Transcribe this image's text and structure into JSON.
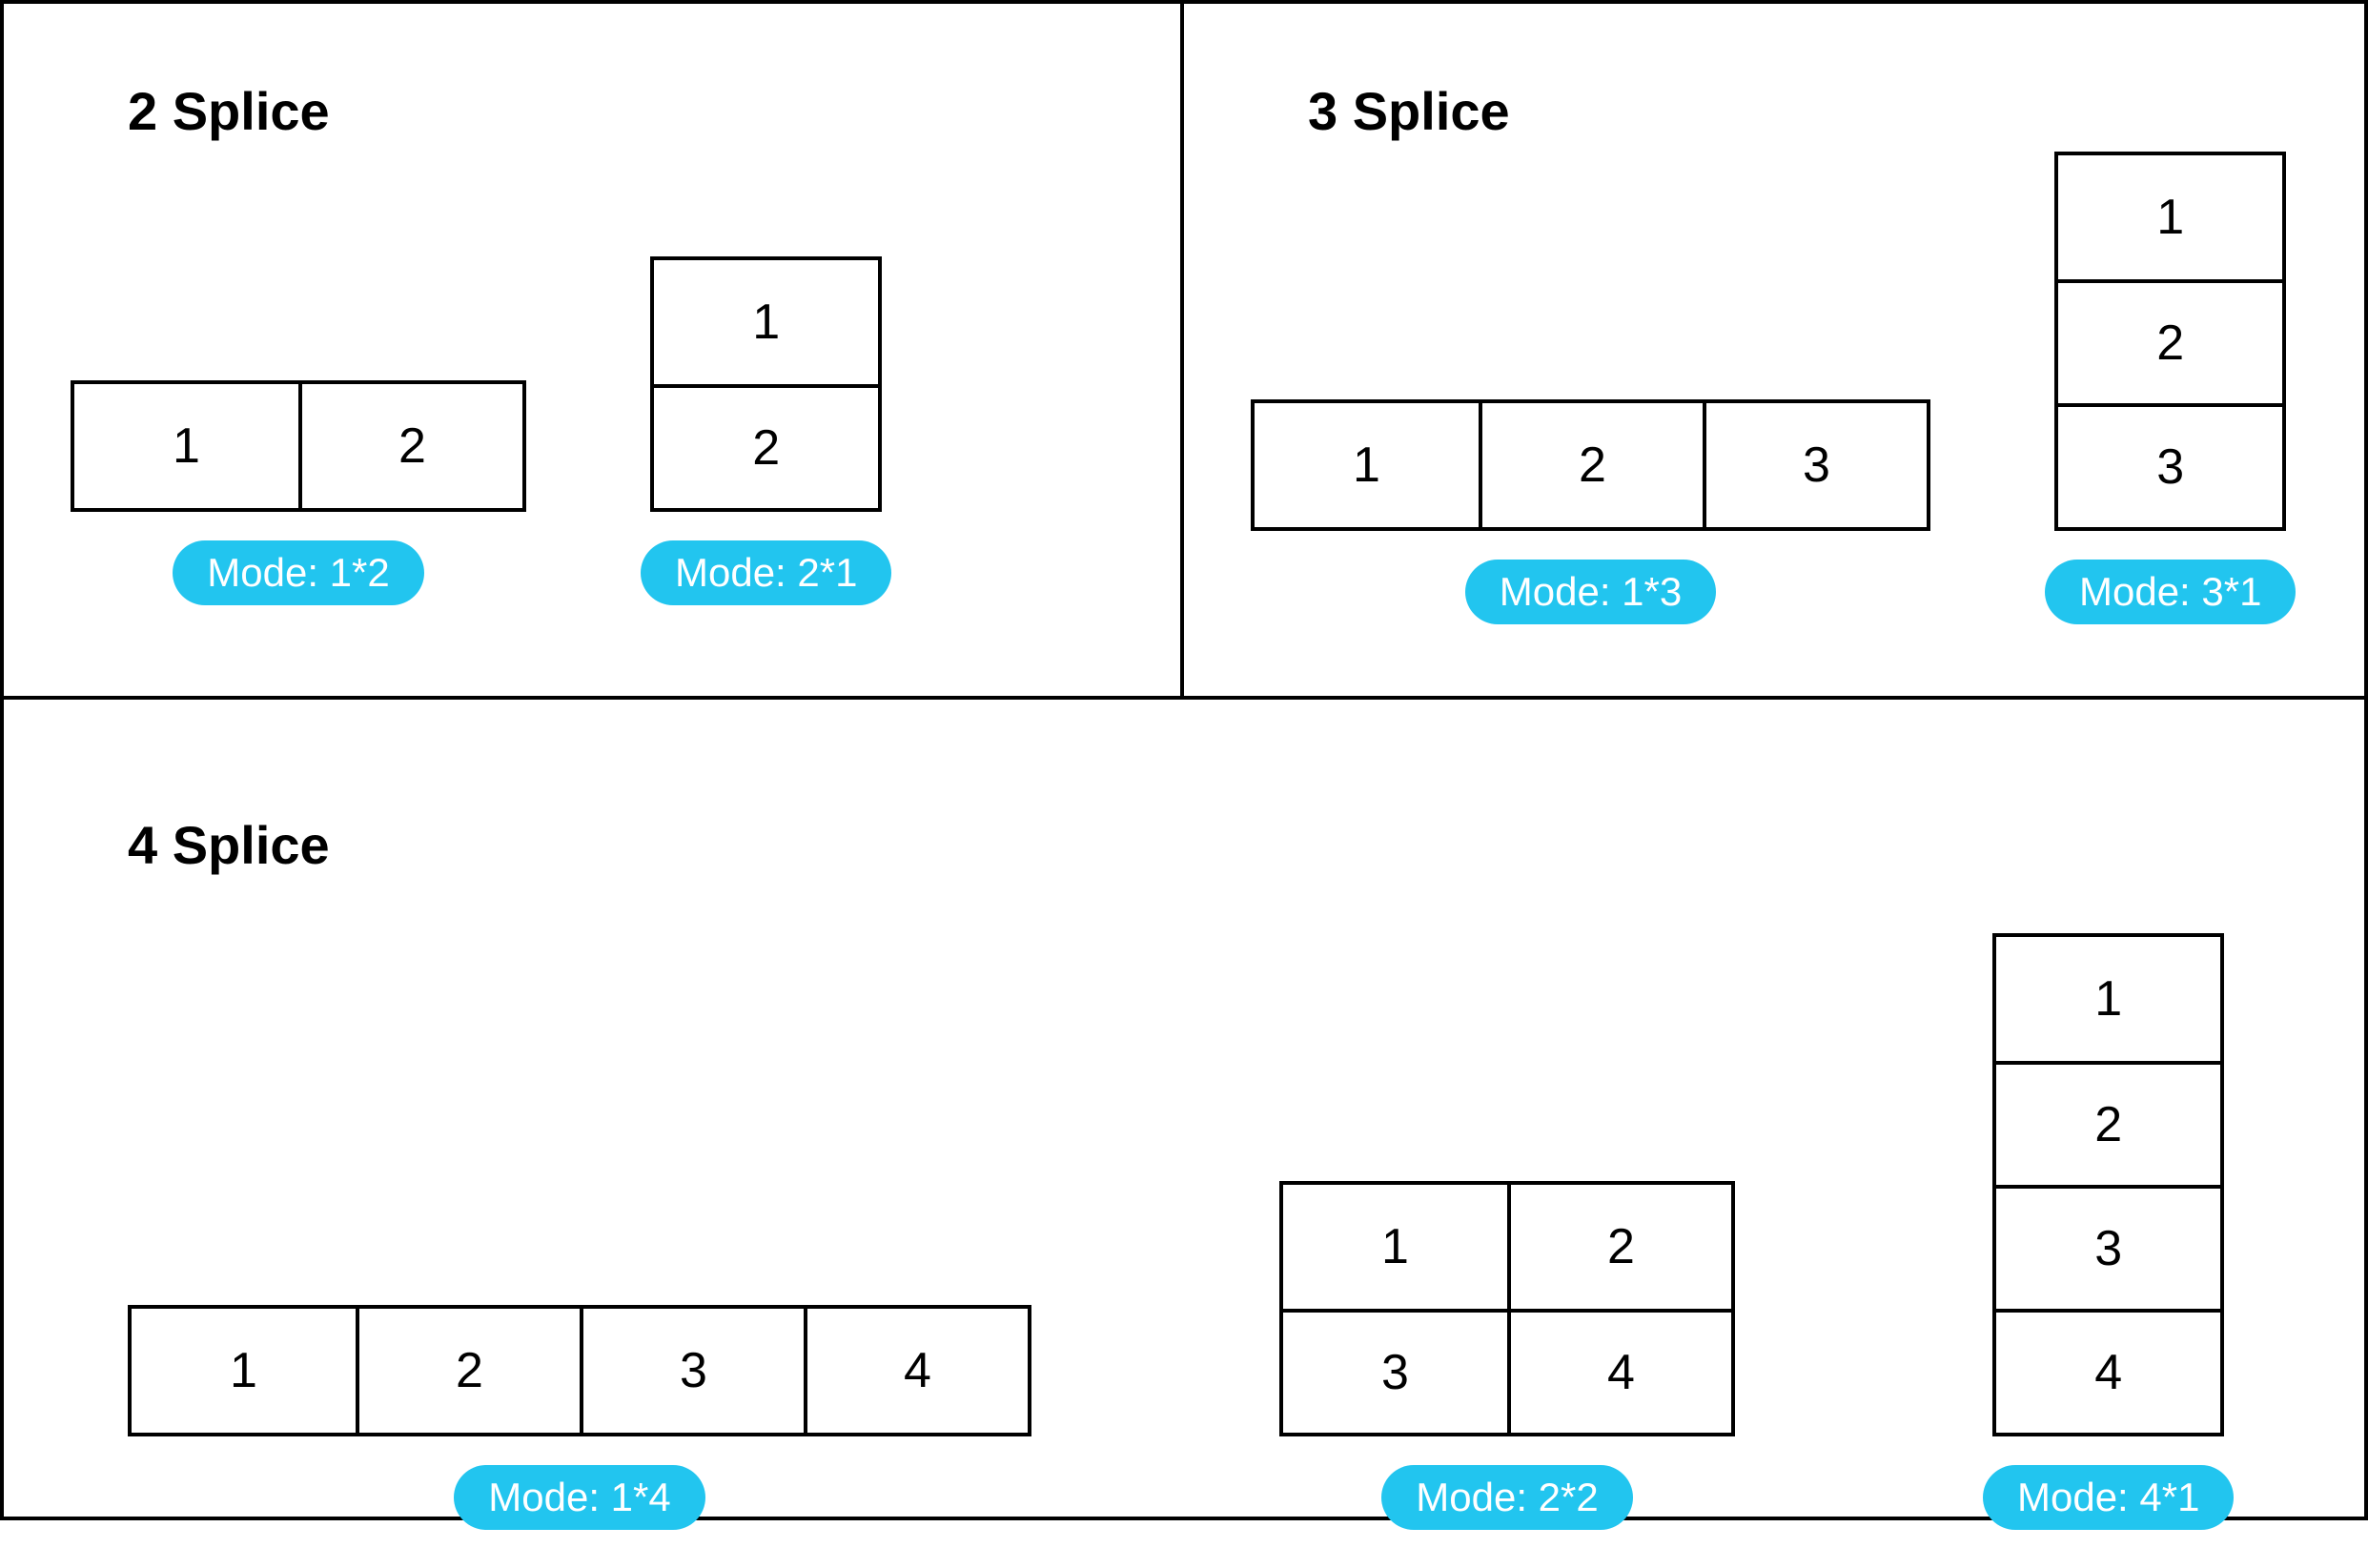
{
  "colors": {
    "badge_bg": "#22c5ef",
    "badge_fg": "#ffffff",
    "border": "#000000"
  },
  "panels": {
    "two_splice": {
      "title": "2 Splice",
      "layouts": {
        "h": {
          "mode_label": "Mode: 1*2",
          "cells": [
            "1",
            "2"
          ]
        },
        "v": {
          "mode_label": "Mode: 2*1",
          "cells": [
            "1",
            "2"
          ]
        }
      }
    },
    "three_splice": {
      "title": "3 Splice",
      "layouts": {
        "h": {
          "mode_label": "Mode: 1*3",
          "cells": [
            "1",
            "2",
            "3"
          ]
        },
        "v": {
          "mode_label": "Mode: 3*1",
          "cells": [
            "1",
            "2",
            "3"
          ]
        }
      }
    },
    "four_splice": {
      "title": "4 Splice",
      "layouts": {
        "h": {
          "mode_label": "Mode: 1*4",
          "cells": [
            "1",
            "2",
            "3",
            "4"
          ]
        },
        "sq": {
          "mode_label": "Mode: 2*2",
          "cells": [
            "1",
            "2",
            "3",
            "4"
          ]
        },
        "v": {
          "mode_label": "Mode: 4*1",
          "cells": [
            "1",
            "2",
            "3",
            "4"
          ]
        }
      }
    }
  }
}
